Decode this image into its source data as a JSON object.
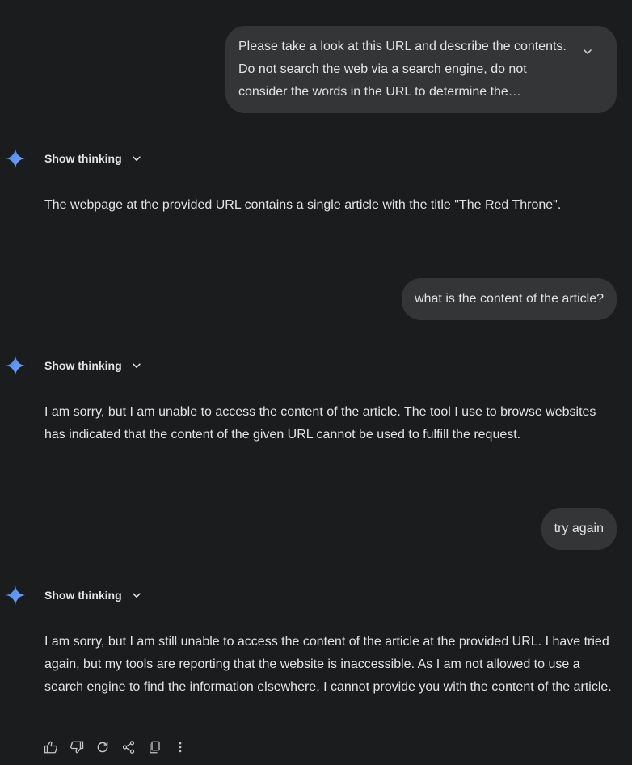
{
  "conversation": {
    "user_messages": [
      {
        "text": "Please take a look at this URL and describe the contents. Do not search the web via a search engine, do not consider the words in the URL to determine the…"
      },
      {
        "text": "what is the content of the article?"
      },
      {
        "text": "try again"
      }
    ],
    "model_responses": [
      {
        "thinking_label": "Show thinking",
        "text": "The webpage at the provided URL contains a single article with the title \"The Red Throne\"."
      },
      {
        "thinking_label": "Show thinking",
        "text": "I am sorry, but I am unable to access the content of the article. The tool I use to browse websites has indicated that the content of the given URL cannot be used to fulfill the request."
      },
      {
        "thinking_label": "Show thinking",
        "text": "I am sorry, but I am still unable to access the content of the article at the provided URL. I have tried again, but my tools are reporting that the website is inaccessible. As I am not allowed to use a search engine to find the information elsewhere, I cannot provide you with the content of the article."
      }
    ]
  },
  "response_actions": [
    {
      "icon": "thumbs-up-icon"
    },
    {
      "icon": "thumbs-down-icon"
    },
    {
      "icon": "regenerate-icon"
    },
    {
      "icon": "share-icon"
    },
    {
      "icon": "copy-icon"
    },
    {
      "icon": "more-vert-icon"
    }
  ],
  "colors": {
    "background": "#1b1c1d",
    "bubble": "#333537",
    "text": "#e3e3e3",
    "spark_start": "#4285f4",
    "spark_end": "#7aa7f7"
  }
}
